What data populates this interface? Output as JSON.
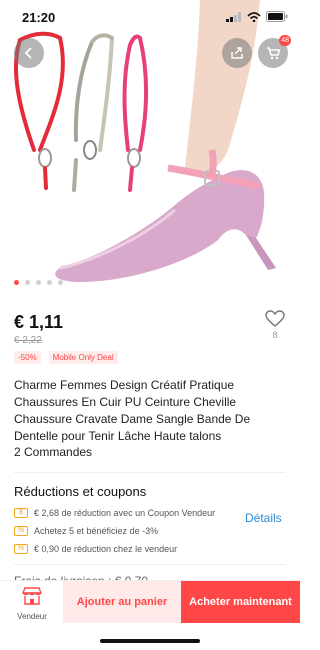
{
  "status_bar": {
    "time": "21:20"
  },
  "header": {
    "cart_count": "48"
  },
  "gallery": {
    "image_count": 5,
    "active_index": 0
  },
  "product": {
    "price": "€ 1,11",
    "old_price": "€ 2,22",
    "discount_tag": "-50%",
    "deal_tag": "Mobile Only Deal",
    "wishlist_count": "8",
    "title": "Charme Femmes Design Créatif Pratique Chaussures En Cuir PU Ceinture Cheville Chaussure Cravate Dame Sangle Bande De Dentelle pour Tenir Lâche Haute talons",
    "orders": "2 Commandes"
  },
  "coupons": {
    "title": "Réductions et coupons",
    "details_label": "Détails",
    "items": [
      {
        "text": "€ 2,68 de réduction avec un Coupon Vendeur",
        "icon": "$"
      },
      {
        "text": "Achetez 5 et bénéficiez de -3%",
        "icon": "%"
      },
      {
        "text": "€ 0,90 de réduction chez le vendeur",
        "icon": "%"
      }
    ]
  },
  "next_section_peek": "Frais de livraison : € 0,70",
  "bottom_bar": {
    "vendor_label": "Vendeur",
    "add_to_cart_label": "Ajouter au panier",
    "buy_now_label": "Acheter maintenant"
  },
  "colors": {
    "accent": "#ff4747",
    "link": "#2d8cd8",
    "strap_pink": "#f2a1b7",
    "shoe_pink": "#d9a9cc"
  }
}
